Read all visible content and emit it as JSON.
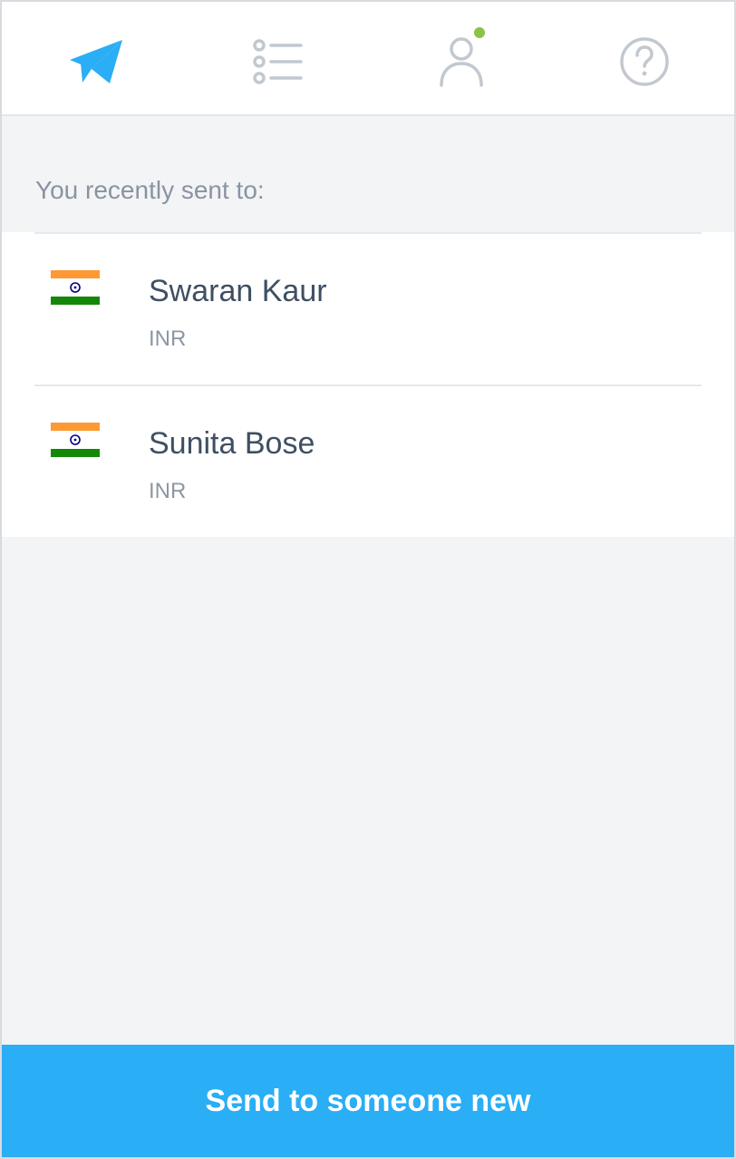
{
  "nav": {
    "items": [
      {
        "icon": "paper-plane-icon",
        "active": true
      },
      {
        "icon": "list-icon",
        "active": false
      },
      {
        "icon": "account-icon",
        "active": false,
        "has_notification": true
      },
      {
        "icon": "help-icon",
        "active": false
      }
    ]
  },
  "recent": {
    "label": "You recently sent to:",
    "recipients": [
      {
        "name": "Swaran Kaur",
        "currency": "INR",
        "flag": "india-flag-icon"
      },
      {
        "name": "Sunita Bose",
        "currency": "INR",
        "flag": "india-flag-icon"
      }
    ]
  },
  "cta": {
    "label": "Send to someone new"
  },
  "colors": {
    "accent": "#2aaef5",
    "icon_inactive": "#c2c8cf",
    "notification_dot": "#8bc34a",
    "background": "#f3f4f6",
    "saffron": "#ff9933",
    "india_green": "#138808",
    "chakra_navy": "#000080"
  }
}
